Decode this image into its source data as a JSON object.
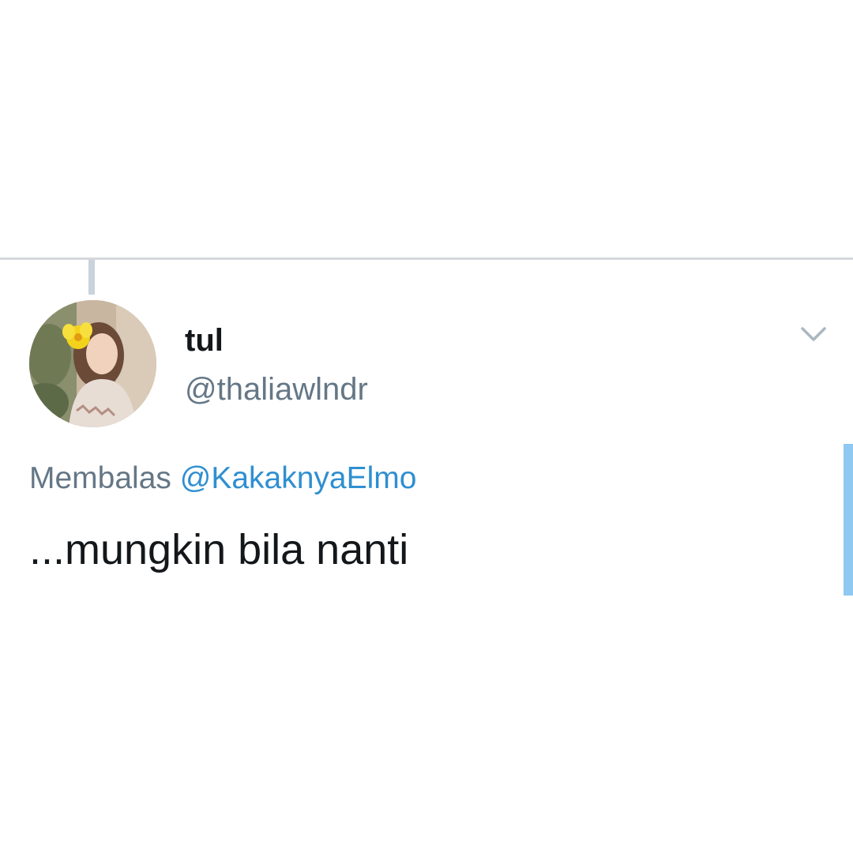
{
  "tweet": {
    "display_name": "tul",
    "handle": "@thaliawlndr",
    "reply_prefix": "Membalas",
    "reply_mention": "@KakaknyaElmo",
    "text": "...mungkin bila nanti"
  },
  "icons": {
    "menu": "chevron-down-icon",
    "avatar": "profile-photo"
  },
  "colors": {
    "text_primary": "#14171a",
    "text_secondary": "#657786",
    "mention": "#2f8fd1",
    "divider": "#d4d8dc",
    "scroll_indicator": "#8fc8f0"
  }
}
